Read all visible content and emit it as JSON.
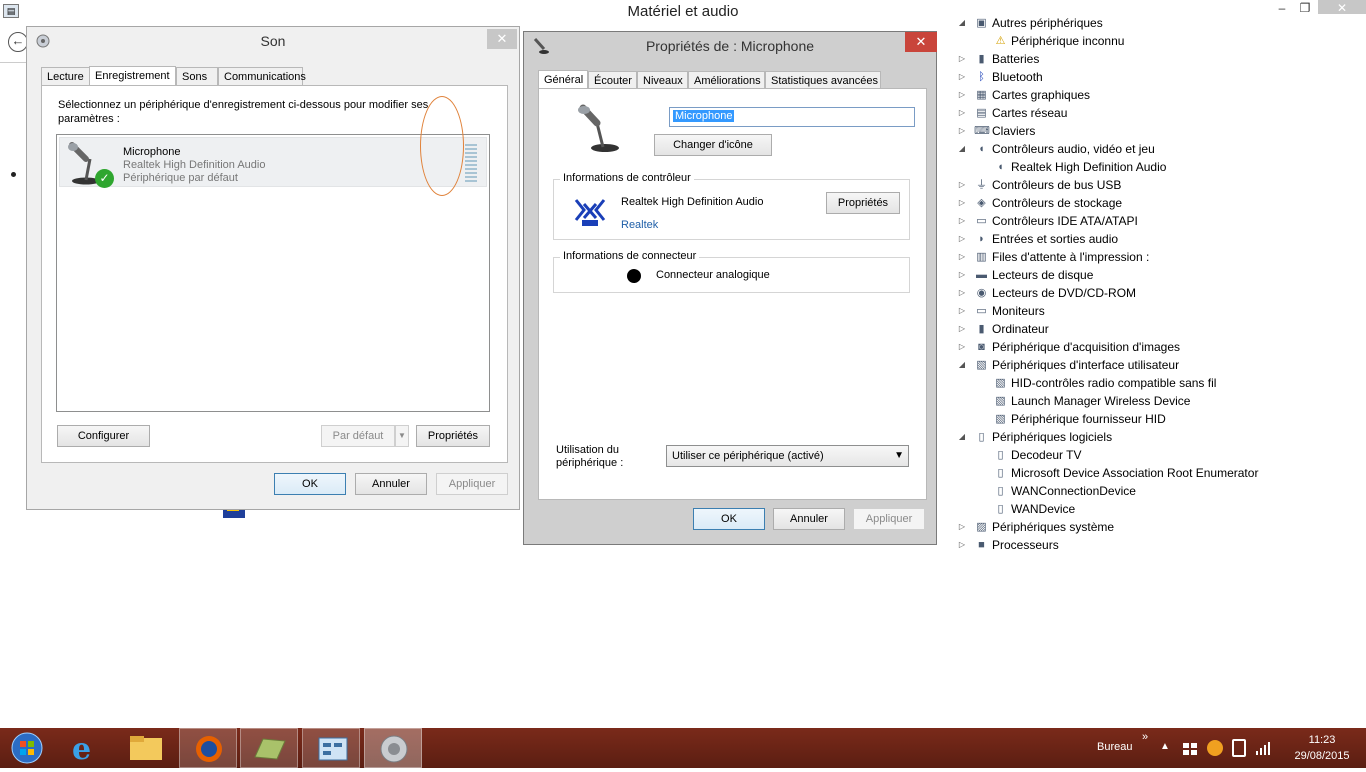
{
  "control_panel": {
    "title": "Matériel et audio",
    "app_icon": "control-panel-icon",
    "back_icon": "back-arrow-icon",
    "window_buttons": {
      "minimize": "–",
      "maximize": "❐",
      "close": "✕"
    }
  },
  "son": {
    "title": "Son",
    "close_glyph": "✕",
    "tabs": [
      "Lecture",
      "Enregistrement",
      "Sons",
      "Communications"
    ],
    "active_tab": "Enregistrement",
    "instruction": "Sélectionnez un périphérique d'enregistrement ci-dessous pour modifier ses paramètres :",
    "device": {
      "name": "Microphone",
      "driver": "Realtek High Definition Audio",
      "status": "Périphérique par défaut",
      "icon": "microphone-icon",
      "check_glyph": "✓"
    },
    "buttons": {
      "configure": "Configurer",
      "default": "Par défaut",
      "properties": "Propriétés",
      "ok": "OK",
      "cancel": "Annuler",
      "apply": "Appliquer"
    }
  },
  "props": {
    "title": "Propriétés de : Microphone",
    "close_glyph": "✕",
    "tabs": [
      "Général",
      "Écouter",
      "Niveaux",
      "Améliorations",
      "Statistiques avancées"
    ],
    "active_tab": "Général",
    "device_name_value": "Microphone",
    "change_icon_label": "Changer d'icône",
    "controller": {
      "heading": "Informations de contrôleur",
      "name": "Realtek High Definition Audio",
      "vendor": "Realtek",
      "properties_label": "Propriétés",
      "icon": "realtek-icon"
    },
    "connector": {
      "heading": "Informations de connecteur",
      "name": "Connecteur analogique",
      "icon": "connector-dot-icon"
    },
    "usage": {
      "label": "Utilisation du périphérique :",
      "selected": "Utiliser ce périphérique (activé)"
    },
    "buttons": {
      "ok": "OK",
      "cancel": "Annuler",
      "apply": "Appliquer"
    }
  },
  "device_manager": {
    "items": [
      {
        "label": "Autres périphériques",
        "level": 0,
        "expanded": true,
        "icon": "other-devices-icon"
      },
      {
        "label": "Périphérique inconnu",
        "level": 1,
        "icon": "warning-device-icon"
      },
      {
        "label": "Batteries",
        "level": 0,
        "expanded": false,
        "icon": "battery-icon"
      },
      {
        "label": "Bluetooth",
        "level": 0,
        "expanded": false,
        "icon": "bluetooth-icon"
      },
      {
        "label": "Cartes graphiques",
        "level": 0,
        "expanded": false,
        "icon": "display-adapter-icon"
      },
      {
        "label": "Cartes réseau",
        "level": 0,
        "expanded": false,
        "icon": "network-adapter-icon"
      },
      {
        "label": "Claviers",
        "level": 0,
        "expanded": false,
        "icon": "keyboard-icon"
      },
      {
        "label": "Contrôleurs audio, vidéo et jeu",
        "level": 0,
        "expanded": true,
        "icon": "audio-icon"
      },
      {
        "label": "Realtek High Definition Audio",
        "level": 1,
        "icon": "audio-icon"
      },
      {
        "label": "Contrôleurs de bus USB",
        "level": 0,
        "expanded": false,
        "icon": "usb-icon"
      },
      {
        "label": "Contrôleurs de stockage",
        "level": 0,
        "expanded": false,
        "icon": "storage-icon"
      },
      {
        "label": "Contrôleurs IDE ATA/ATAPI",
        "level": 0,
        "expanded": false,
        "icon": "ide-icon"
      },
      {
        "label": "Entrées et sorties audio",
        "level": 0,
        "expanded": false,
        "icon": "audio-io-icon"
      },
      {
        "label": "Files d'attente à l'impression :",
        "level": 0,
        "expanded": false,
        "icon": "printer-icon"
      },
      {
        "label": "Lecteurs de disque",
        "level": 0,
        "expanded": false,
        "icon": "disk-icon"
      },
      {
        "label": "Lecteurs de DVD/CD-ROM",
        "level": 0,
        "expanded": false,
        "icon": "dvd-icon"
      },
      {
        "label": "Moniteurs",
        "level": 0,
        "expanded": false,
        "icon": "monitor-icon"
      },
      {
        "label": "Ordinateur",
        "level": 0,
        "expanded": false,
        "icon": "computer-icon"
      },
      {
        "label": "Périphérique d'acquisition d'images",
        "level": 0,
        "expanded": false,
        "icon": "camera-icon"
      },
      {
        "label": "Périphériques d'interface utilisateur",
        "level": 0,
        "expanded": true,
        "icon": "hid-icon"
      },
      {
        "label": "HID-contrôles radio compatible sans fil",
        "level": 1,
        "icon": "hid-icon"
      },
      {
        "label": "Launch Manager Wireless Device",
        "level": 1,
        "icon": "hid-icon"
      },
      {
        "label": "Périphérique fournisseur HID",
        "level": 1,
        "icon": "hid-icon"
      },
      {
        "label": "Périphériques logiciels",
        "level": 0,
        "expanded": true,
        "icon": "software-device-icon"
      },
      {
        "label": "Decodeur TV",
        "level": 1,
        "icon": "software-device-icon"
      },
      {
        "label": "Microsoft Device Association Root Enumerator",
        "level": 1,
        "icon": "software-device-icon"
      },
      {
        "label": "WANConnectionDevice",
        "level": 1,
        "icon": "software-device-icon"
      },
      {
        "label": "WANDevice",
        "level": 1,
        "icon": "software-device-icon"
      },
      {
        "label": "Périphériques système",
        "level": 0,
        "expanded": false,
        "icon": "system-device-icon"
      },
      {
        "label": "Processeurs",
        "level": 0,
        "expanded": false,
        "icon": "processor-icon"
      }
    ]
  },
  "taskbar": {
    "apps": [
      {
        "name": "start",
        "icon": "windows-start-icon"
      },
      {
        "name": "ie",
        "icon": "internet-explorer-icon"
      },
      {
        "name": "explorer",
        "icon": "file-explorer-icon"
      },
      {
        "name": "firefox",
        "icon": "firefox-icon"
      },
      {
        "name": "map",
        "icon": "map-app-icon"
      },
      {
        "name": "control-panel",
        "icon": "control-panel-icon"
      },
      {
        "name": "sound",
        "icon": "speaker-icon"
      }
    ],
    "bureau": "Bureau",
    "chevron": "»",
    "time": "11:23",
    "date": "29/08/2015",
    "colors": {
      "taskbar": "#6b2416",
      "accent": "#3399ff",
      "close_red": "#c9453b"
    }
  }
}
